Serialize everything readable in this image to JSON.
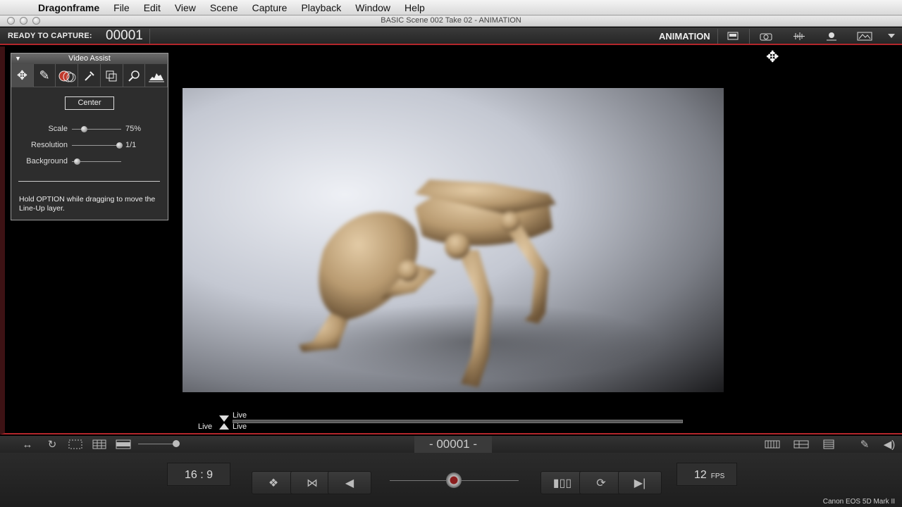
{
  "menubar": {
    "app_name": "Dragonframe",
    "items": [
      "File",
      "Edit",
      "View",
      "Scene",
      "Capture",
      "Playback",
      "Window",
      "Help"
    ]
  },
  "window": {
    "title": "BASIC  Scene 002  Take 02 - ANIMATION"
  },
  "toolbar": {
    "status_label": "READY TO CAPTURE:",
    "frame_number": "00001",
    "mode": "ANIMATION",
    "icons": [
      "display-icon",
      "camera-icon",
      "waveform-icon",
      "light-icon",
      "screen-icon",
      "menu-triangle-icon"
    ]
  },
  "video_assist": {
    "title": "Video Assist",
    "tools": [
      "move-icon",
      "pencil-icon",
      "layers-icon",
      "eyedropper-icon",
      "copy-icon",
      "magnifier-icon",
      "histogram-icon"
    ],
    "center_label": "Center",
    "scale": {
      "label": "Scale",
      "value": "75%",
      "level": 0.2
    },
    "resolution": {
      "label": "Resolution",
      "value": "1/1",
      "level": 0.95
    },
    "background": {
      "label": "Background",
      "level": 0.05
    },
    "hint": "Hold OPTION while dragging to move the Line-Up layer."
  },
  "timeline": {
    "top_label": "Live",
    "left_label": "Live",
    "bottom_label": "Live"
  },
  "bottombar": {
    "frame_display": "- 00001 -"
  },
  "controls": {
    "aspect_ratio": "16 : 9",
    "fps_value": "12",
    "fps_unit": "FPS",
    "camera_name": "Canon EOS 5D Mark II"
  },
  "colors": {
    "accent_red": "#b3262b",
    "panel_bg": "#2d2d2d"
  }
}
